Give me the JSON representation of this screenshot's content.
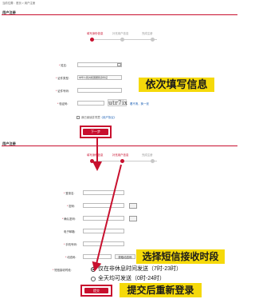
{
  "breadcrumb": "当前位置：首页 > 用户注册",
  "section_title": "用户注册",
  "steps_top": [
    "填写身份信息",
    "补充用户信息",
    "完成注册"
  ],
  "steps_bottom": [
    "填写身份信息",
    "补充用户信息",
    "完成注册"
  ],
  "form1": {
    "name_label": "姓名:",
    "id_type_label": "证件类型:",
    "id_type_value": "中华人民共和国居民身份证",
    "id_number_label": "证件号码:",
    "captcha_label": "验证码:",
    "captcha_text": "utr7ix",
    "captcha_refresh": "看不清，换一张",
    "agree_text": "我已阅读并同意",
    "agree_link": "《用户协议》",
    "next_button": "下一步"
  },
  "form2": {
    "login_label": "登录名:",
    "password_label": "密码:",
    "confirm_label": "确认密码:",
    "email_label": "电子邮箱:",
    "phone_label": "手机号码:",
    "code_label": "动态码:",
    "get_code_button": "获取动态码",
    "sms_time_label": "短信接收时段:",
    "sms_options": [
      "仅在非休息时间发送（7时-23时）",
      "全天均可发送（0时-24时）"
    ],
    "submit_button": "提交"
  },
  "annotations": {
    "fill_info": "依次填写信息",
    "choose_sms": "选择短信接收时段",
    "submit_relogin": "提交后重新登录"
  }
}
